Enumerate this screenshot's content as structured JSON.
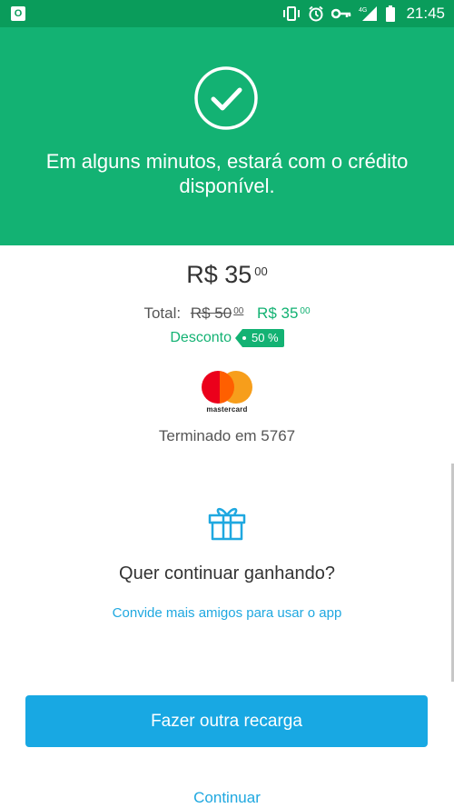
{
  "status_bar": {
    "time": "21:45",
    "network": "4G",
    "icons": [
      "outlook-icon",
      "vibrate-icon",
      "alarm-icon",
      "vpn-key-icon",
      "signal-icon",
      "battery-icon"
    ]
  },
  "header": {
    "message": "Em alguns minutos, estará com o crédito disponível.",
    "icon": "check-circle-icon"
  },
  "amount": {
    "main": "R$ 35",
    "cents": "00"
  },
  "total": {
    "label": "Total:",
    "old_price": "R$ 50",
    "old_cents": "00",
    "new_price": "R$ 35",
    "new_cents": "00"
  },
  "discount": {
    "label": "Desconto",
    "value": "50 %"
  },
  "payment": {
    "brand": "mastercard",
    "ending_text": "Terminado em 5767"
  },
  "invite": {
    "icon": "gift-icon",
    "question": "Quer continuar ganhando?",
    "link": "Convide mais amigos para usar o app"
  },
  "actions": {
    "primary": "Fazer outra recarga",
    "secondary": "Continuar"
  },
  "colors": {
    "green": "#13b273",
    "status_green": "#0a9c5b",
    "blue": "#18a8e3",
    "link_blue": "#1fa8e0"
  }
}
